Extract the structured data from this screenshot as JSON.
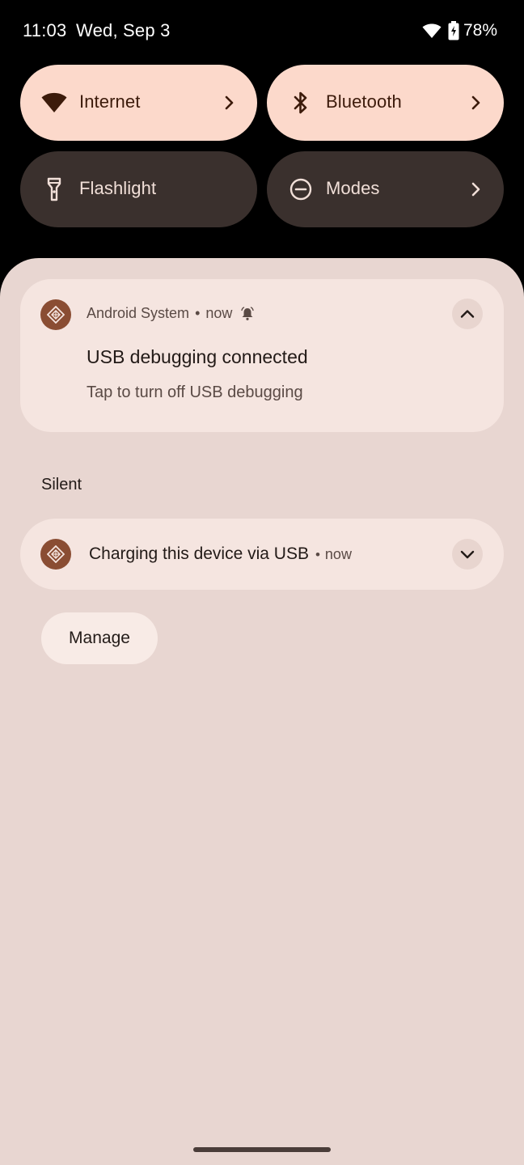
{
  "status_bar": {
    "time": "11:03",
    "date": "Wed, Sep 3",
    "battery_percent": "78%"
  },
  "quick_tiles": [
    {
      "label": "Internet",
      "icon": "wifi-icon",
      "state": "on",
      "has_chevron": true
    },
    {
      "label": "Bluetooth",
      "icon": "bluetooth-icon",
      "state": "on",
      "has_chevron": true
    },
    {
      "label": "Flashlight",
      "icon": "flashlight-icon",
      "state": "off",
      "has_chevron": false
    },
    {
      "label": "Modes",
      "icon": "do-not-disturb-icon",
      "state": "off",
      "has_chevron": true
    }
  ],
  "notifications": {
    "usb_debugging": {
      "app_name": "Android System",
      "separator": "•",
      "time": "now",
      "title": "USB debugging connected",
      "text": "Tap to turn off USB debugging",
      "expanded": true
    },
    "silent_section_label": "Silent",
    "charging": {
      "title": "Charging this device via USB",
      "separator": "•",
      "time": "now",
      "expanded": false
    },
    "manage_label": "Manage"
  },
  "colors": {
    "tile_on_bg": "#fcd9cb",
    "tile_off_bg": "#3a302d",
    "shade_bg": "#e8d6d1",
    "card_bg": "#f5e5e0",
    "app_icon_bg": "#8a4d33"
  }
}
